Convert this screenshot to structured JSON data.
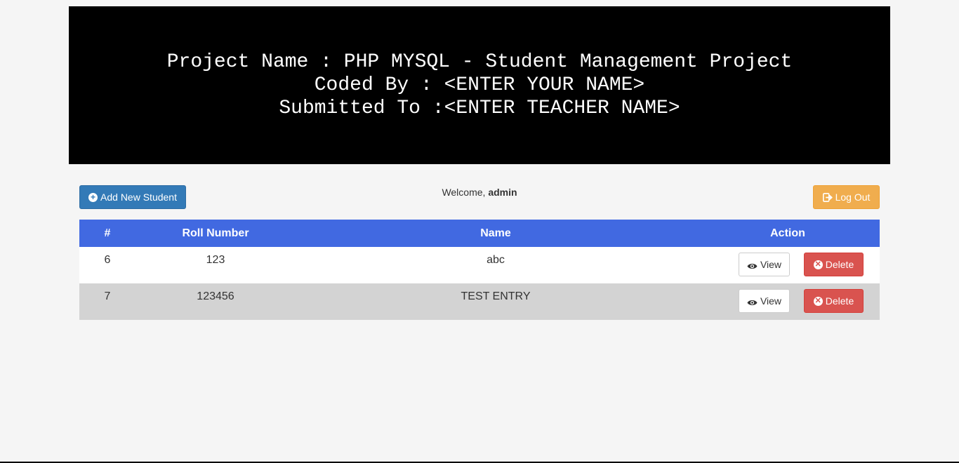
{
  "banner": {
    "line1": "Project Name : PHP MYSQL - Student Management Project",
    "line2": "Coded By : <ENTER YOUR NAME>",
    "line3": "Submitted To :<ENTER TEACHER NAME>"
  },
  "toolbar": {
    "add_label": "Add New Student",
    "welcome_prefix": "Welcome, ",
    "welcome_user": "admin",
    "logout_label": "Log Out"
  },
  "table": {
    "headers": [
      "#",
      "Roll Number",
      "Name",
      "Action"
    ],
    "rows": [
      {
        "id": "6",
        "roll": "123",
        "name": "abc",
        "view_label": "View",
        "delete_label": "Delete"
      },
      {
        "id": "7",
        "roll": "123456",
        "name": "TEST ENTRY",
        "view_label": "View",
        "delete_label": "Delete"
      }
    ]
  },
  "colors": {
    "banner_bg": "#000000",
    "header_bg": "#4169e1",
    "primary": "#337ab7",
    "warning": "#f0ad4e",
    "danger": "#d9534f",
    "row_alt": "#d3d3d3",
    "page_bg": "#f5f5f5"
  },
  "icons": {
    "add": "plus-circle-icon",
    "logout": "logout-icon",
    "view": "eye-icon",
    "delete": "remove-circle-icon"
  }
}
